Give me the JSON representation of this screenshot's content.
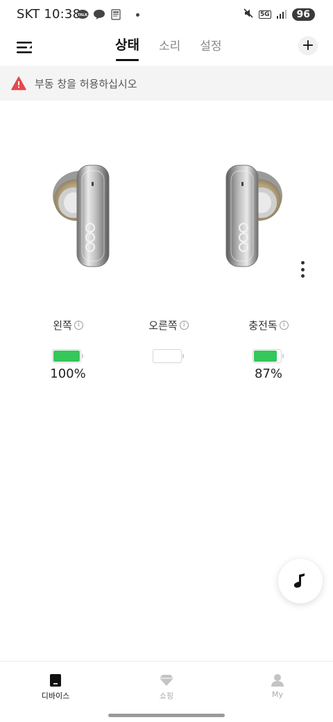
{
  "status_bar": {
    "carrier": "SKT",
    "time": "10:38",
    "notification_icons": [
      "talk-icon",
      "chat-bubble-icon",
      "news-icon"
    ],
    "network": "5G",
    "battery": "96"
  },
  "header": {
    "tabs": [
      {
        "label": "상태",
        "active": true
      },
      {
        "label": "소리",
        "active": false
      },
      {
        "label": "설정",
        "active": false
      }
    ],
    "add_label": "+"
  },
  "banner": {
    "text": "부동 창을 허용하십시오",
    "color": "#e5484d"
  },
  "batteries": [
    {
      "label": "왼쪽",
      "value_text": "100%",
      "level": 1.0,
      "show_value": true
    },
    {
      "label": "오른쪽",
      "value_text": "",
      "level": 0,
      "show_value": false
    },
    {
      "label": "충전독",
      "value_text": "87%",
      "level": 0.87,
      "show_value": true
    }
  ],
  "accent_color": "#34c759",
  "bottom_nav": [
    {
      "label": "디바이스",
      "icon": "device-icon",
      "active": true
    },
    {
      "label": "쇼핑",
      "icon": "diamond-icon",
      "active": false
    },
    {
      "label": "My",
      "icon": "person-icon",
      "active": false
    }
  ]
}
